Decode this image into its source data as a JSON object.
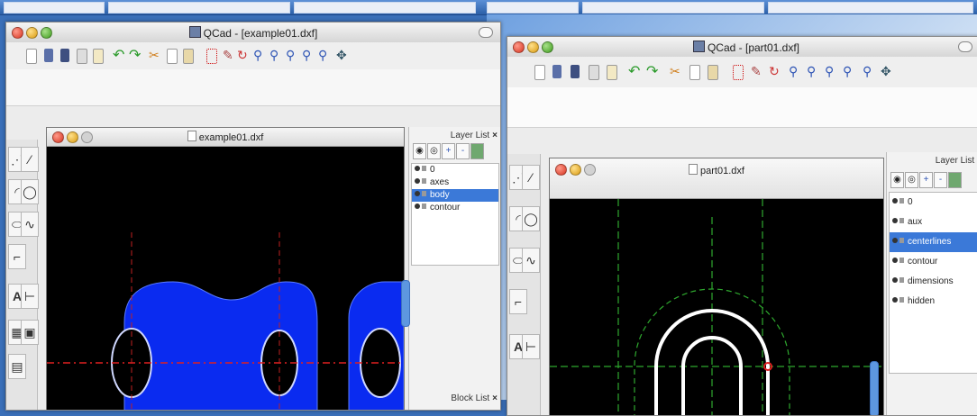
{
  "window_left": {
    "title": "QCad - [example01.dxf]",
    "document_title": "example01.dxf",
    "layer_panel_title": "Layer List",
    "block_panel_title": "Block List",
    "layers": [
      {
        "name": "0",
        "selected": false
      },
      {
        "name": "axes",
        "selected": false
      },
      {
        "name": "body",
        "selected": true
      },
      {
        "name": "contour",
        "selected": false
      }
    ]
  },
  "window_right": {
    "title": "QCad - [part01.dxf]",
    "document_title": "part01.dxf",
    "layer_panel_title": "Layer List",
    "layers": [
      {
        "name": "0",
        "selected": false
      },
      {
        "name": "aux",
        "selected": false
      },
      {
        "name": "centerlines",
        "selected": true
      },
      {
        "name": "contour",
        "selected": false
      },
      {
        "name": "dimensions",
        "selected": false
      },
      {
        "name": "hidden",
        "selected": false
      }
    ]
  },
  "close_glyph": "×",
  "colors": {
    "canvas": "#000000",
    "body_fill": "#0a2bf0",
    "axis_red": "#e02020",
    "centerline_green": "#2ea82e",
    "contour_white": "#ffffff",
    "selection": "#3b79d8"
  },
  "toolbar_icons": [
    "new-file-icon",
    "open-icon",
    "save-icon",
    "print-icon",
    "print-preview-icon",
    "undo-icon",
    "redo-icon",
    "cut-icon",
    "copy-icon",
    "paste-icon",
    "grid-icon",
    "draft-icon",
    "redraw-icon",
    "zoom-in-icon",
    "zoom-out-icon",
    "zoom-auto-icon",
    "zoom-previous-icon",
    "zoom-window-icon",
    "zoom-pan-icon"
  ],
  "tool_icons": [
    "point-icon",
    "line-icon",
    "arc-icon",
    "circle-icon",
    "ellipse-icon",
    "spline-icon",
    "polyline-icon",
    "text-icon",
    "dimension-icon",
    "hatch-icon",
    "image-icon",
    "block-icon"
  ]
}
